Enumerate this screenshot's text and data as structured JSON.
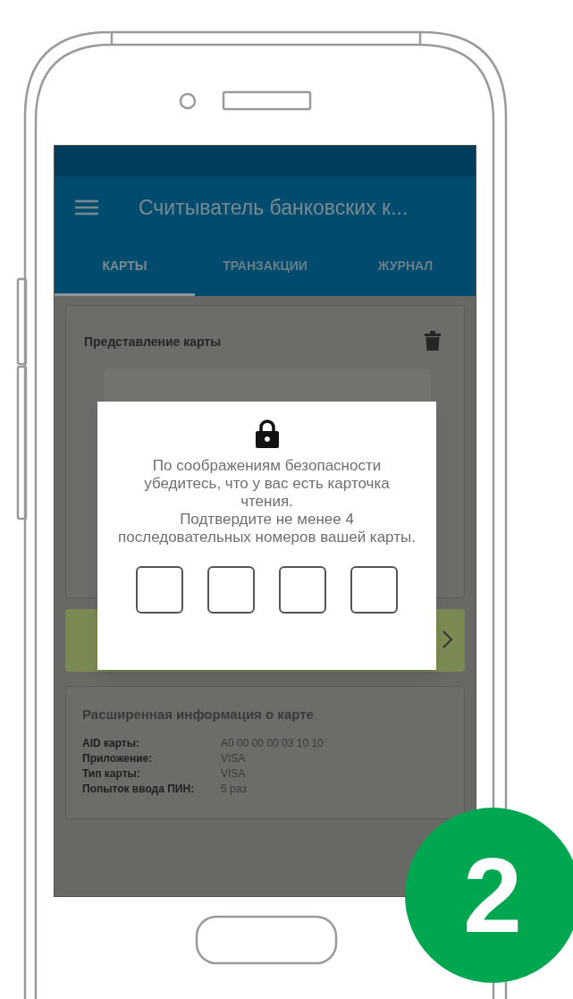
{
  "app_bar": {
    "title": "Считыватель банковских к..."
  },
  "tabs": [
    {
      "label": "КАРТЫ",
      "selected": true
    },
    {
      "label": "ТРАНЗАКЦИИ",
      "selected": false
    },
    {
      "label": "ЖУРНАЛ",
      "selected": false
    }
  ],
  "card_view": {
    "title": "Представление карты"
  },
  "dialog": {
    "paragraphs": [
      "По соображениям безопасности убедитесь, что у вас есть карточка чтения.",
      "Подтвердите не менее 4 последовательных номеров вашей карты."
    ],
    "pin_boxes": [
      {
        "filled": false
      },
      {
        "filled": false
      },
      {
        "filled": false
      },
      {
        "filled": false
      }
    ]
  },
  "extended_info": {
    "title": "Расширенная информация о карте",
    "rows": [
      {
        "label": "AID карты:",
        "value": "A0 00 00 00 03 10 10"
      },
      {
        "label": "Приложение:",
        "value": "VISA"
      },
      {
        "label": "Тип карты:",
        "value": "VISA"
      },
      {
        "label": "Попыток ввода ПИН:",
        "value": "5 раз"
      }
    ]
  },
  "step_badge": "2"
}
